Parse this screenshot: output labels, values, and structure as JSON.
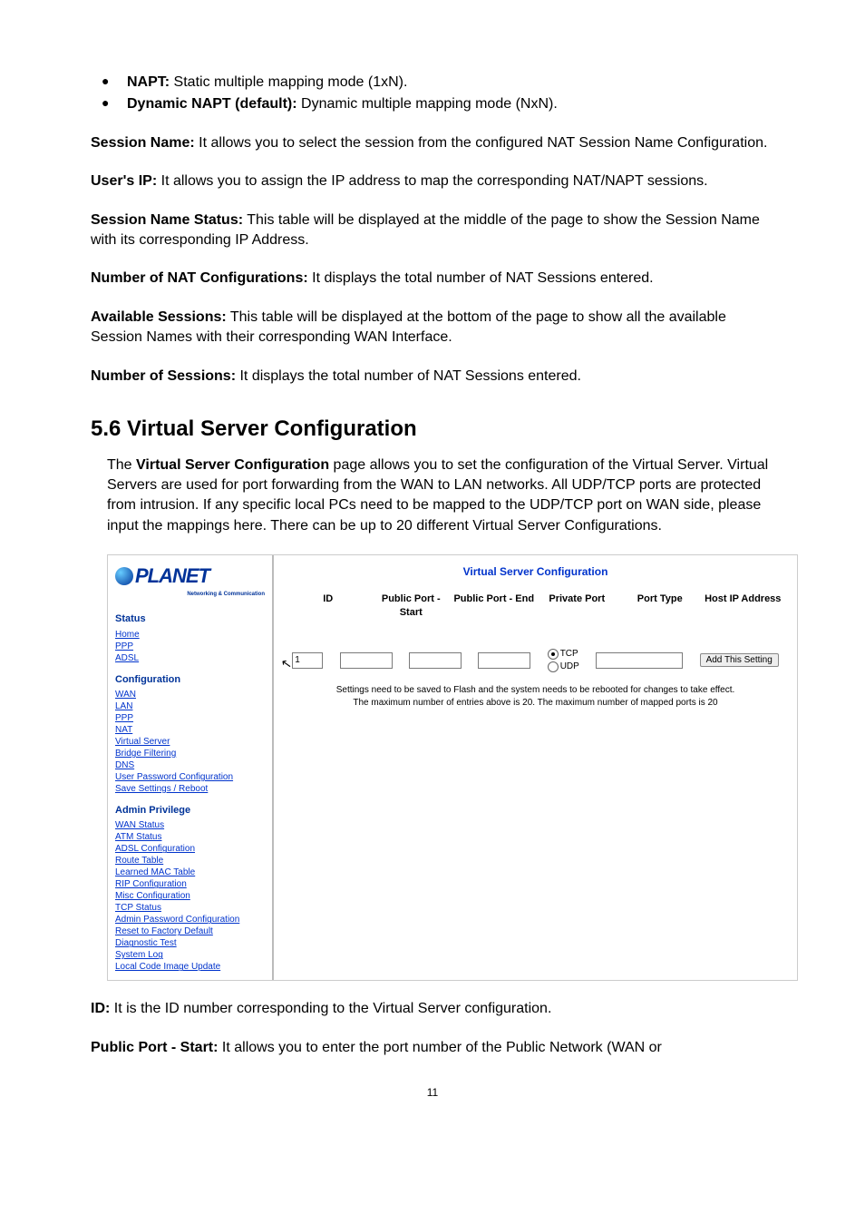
{
  "bullets": [
    {
      "label": "NAPT:",
      "text": " Static multiple mapping mode (1xN)."
    },
    {
      "label": "Dynamic NAPT (default):",
      "text": " Dynamic multiple mapping mode (NxN)."
    }
  ],
  "defs": [
    {
      "label": "Session Name:",
      "text": " It allows you to select the session from the configured NAT Session Name Configuration."
    },
    {
      "label": "User's IP:",
      "text": " It allows you to assign the IP address to map the corresponding NAT/NAPT sessions."
    },
    {
      "label": "Session Name Status:",
      "text": " This table will be displayed at the middle of the page to show the Session Name with its corresponding IP Address."
    },
    {
      "label": "Number of NAT Configurations:",
      "text": " It displays the total number of NAT Sessions entered."
    },
    {
      "label": "Available Sessions:",
      "text": " This table will be displayed at the bottom of the page to show all the available Session Names with their corresponding WAN Interface."
    },
    {
      "label": "Number of Sessions:",
      "text": " It displays the total number of NAT Sessions entered."
    }
  ],
  "section": {
    "heading": "5.6 Virtual Server Configuration",
    "intro_pre": "The ",
    "intro_bold": "Virtual Server Configuration",
    "intro_post": " page allows you to set the configuration of the Virtual Server. Virtual Servers are used for port forwarding from the WAN to LAN networks. All UDP/TCP ports are protected from intrusion. If any specific local PCs need to be mapped to the UDP/TCP port on WAN side, please input the mappings here. There can be up to 20 different Virtual Server Configurations."
  },
  "screenshot": {
    "logo_text": "PLANET",
    "logo_sub": "Networking & Communication",
    "nav": [
      {
        "title": "Status",
        "items": [
          "Home",
          "PPP",
          "ADSL"
        ]
      },
      {
        "title": "Configuration",
        "items": [
          "WAN",
          "LAN",
          "PPP",
          "NAT",
          "Virtual Server",
          "Bridge Filtering",
          "DNS",
          "User Password Configuration",
          "Save Settings / Reboot"
        ]
      },
      {
        "title": "Admin Privilege",
        "items": [
          "WAN Status",
          "ATM Status",
          "ADSL Configuration",
          "Route Table",
          "Learned MAC Table",
          "RIP Configuration",
          "Misc Configuration",
          "TCP Status",
          "Admin Password Configuration",
          "Reset to Factory Default",
          "Diagnostic Test",
          "System Log",
          "Local Code Image Update"
        ]
      }
    ],
    "panel_title": "Virtual Server Configuration",
    "columns": [
      "ID",
      "Public Port - Start",
      "Public Port - End",
      "Private Port",
      "Port Type",
      "Host IP Address"
    ],
    "form": {
      "id_value": "1",
      "port_type": {
        "options": [
          "TCP",
          "UDP"
        ],
        "selected": "TCP"
      },
      "button_label": "Add This Setting"
    },
    "note1": "Settings need to be saved to Flash and the system needs to be rebooted for changes to take effect.",
    "note2": "The maximum number of entries above is  20. The maximum number of mapped ports is  20"
  },
  "defs2": [
    {
      "label": "ID:",
      "text": " It is the ID number corresponding to the Virtual Server configuration."
    },
    {
      "label": "Public Port - Start:",
      "text": " It allows you to enter the port number of the Public Network (WAN or"
    }
  ],
  "page_number": "11"
}
